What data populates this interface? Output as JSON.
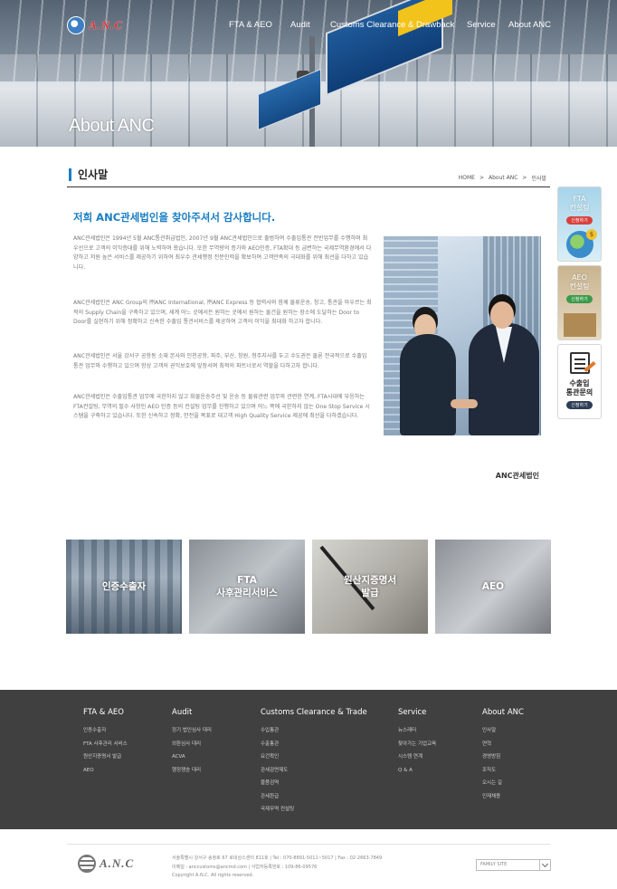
{
  "header": {
    "logo_text": "A.N.C",
    "nav": [
      "FTA & AEO",
      "Audit",
      "Customs Clearance & Drawback",
      "Service",
      "About ANC"
    ],
    "hero_title": "About ANC"
  },
  "page": {
    "section_title": "인사말",
    "breadcrumb": [
      "HOME",
      ">",
      "About ANC",
      ">",
      "인사말"
    ],
    "lead": "저희 ANC관세법인을 찾아주셔서 감사합니다.",
    "paragraphs": [
      "ANC관세법인은 1994년 5월 ANC통관취급법인, 2007년 9월 ANC관세법인으로 출범하여 수출입통관 전반업무를 수행하며 최우선으로 고객의 이익증대를 위해 노력하여 왔습니다. 또한 무역량의 증가와 AEO인증, FTA확대 등 급변하는 국제무역환경에서 다양하고 저원 높은 서비스를 제공하기 위하여 최우수 관세행정 전문인력을 확보하여 고객만족의 극대화를 위해 최선을 다하고 있습니다.",
      "ANC관세법인은 ANC Group의 ㈜ANC International, ㈜ANC Express 등 협력사와 함께 물류운송, 창고, 통관을 아우르는 최적의 Supply Chain을 구축하고 있으며, 세계 어느 곳에서든 원하는 곳에서 원하는 물건을 원하는 장소에 도달하는 Door to Door를 실현하기 위해 정확하고 신속한 수출입 통관서비스를 제공하여 고객의 이익을 최대화 하고자 합니다.",
      "ANC관세법인은 서울 강서구 공항동 소재 본사와 인천공항, 파주, 부산, 창원, 청주지사를 두고 수도권은 물론 전국적으로 수출입통관 업무와 수행하고 있으며 항상 고객의 권익보호에 앞장서며 최적의 파트너로서 역할을 다하고자 합니다.",
      "ANC관세법인은 수출입통관 업무에 국한하지 않고 화물운송주선 및 운송 등 물류관련 업무와 관련한 연계, FTA시대에 부응하는 FTA컨설팅, 무역의 필수 사항인 AEO 인증 등의 컨설팅 업무를 진행하고 있으며 어느 쪽에 국한하지 않는 One Stop Service 시스템을 구축하고 있습니다. 또한 신속하고 정확, 안전을 목표로 대고객 High Quality Service 제공에 최선을 다하겠습니다."
    ],
    "signature": "ANC관세법인"
  },
  "quick_menu": [
    {
      "title": "FTA\n컨설팅",
      "badge": "신청하기"
    },
    {
      "title": "AEO\n컨설팅",
      "badge": "신청하기"
    },
    {
      "title": "수출입\n통관문의",
      "badge": "신청하기"
    }
  ],
  "tiles": [
    "인증수출자",
    "FTA\n사후관리서비스",
    "원산지증명서\n발급",
    "AEO"
  ],
  "footer": {
    "columns": [
      {
        "title": "FTA & AEO",
        "items": [
          "인증수출자",
          "FTA 사후관리 서비스",
          "원산지증명서 발급",
          "AEO"
        ]
      },
      {
        "title": "Audit",
        "items": [
          "정기 법인심사 대리",
          "외환심사 대리",
          "ACVA",
          "행정쟁송 대리"
        ]
      },
      {
        "title": "Customs Clearance & Trade",
        "items": [
          "수입통관",
          "수출통관",
          "요건확인",
          "관세감면제도",
          "물품검역",
          "관세환급",
          "국제무역 컨설팅"
        ]
      },
      {
        "title": "Service",
        "items": [
          "뉴스레터",
          "찾아가는 기업교육",
          "시스템 연계",
          "Q & A"
        ]
      },
      {
        "title": "About ANC",
        "items": [
          "인사말",
          "연혁",
          "경영방침",
          "조직도",
          "오시는 길",
          "인재채용"
        ]
      }
    ],
    "address": "서울특별시 강서구 송정로 67 로네상스센터 811호   |   Tel : 070-8891-5011~5017   |   Fax : 02-2663-7849",
    "email": "이메일 : anccustoms@ancmd.com   |   사업자등록번호 : 109-86-09576",
    "copyright": "Copyright A.N.C. All rights reserved.",
    "family_site": "FAMILY SITE"
  }
}
